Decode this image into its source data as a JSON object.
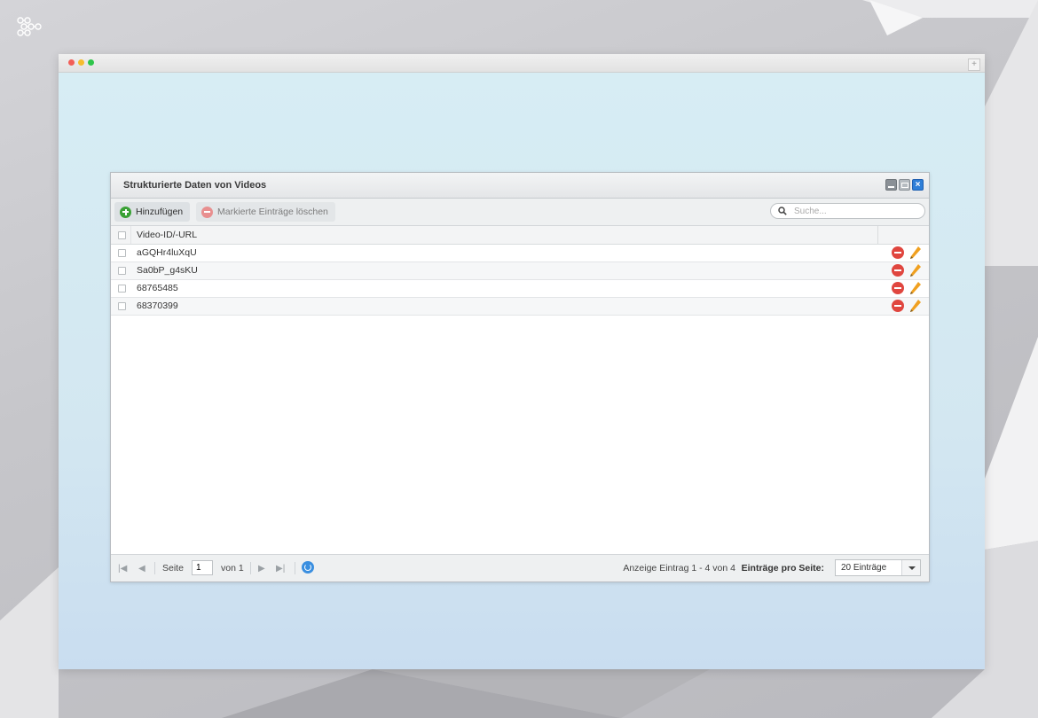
{
  "panel": {
    "title": "Strukturierte Daten von Videos"
  },
  "toolbar": {
    "add_label": "Hinzufügen",
    "delete_label": "Markierte Einträge löschen",
    "search_placeholder": "Suche..."
  },
  "grid": {
    "column_header": "Video-ID/-URL",
    "rows": [
      {
        "value": "aGQHr4luXqU"
      },
      {
        "value": "Sa0bP_g4sKU"
      },
      {
        "value": "68765485"
      },
      {
        "value": "68370399"
      }
    ]
  },
  "footer": {
    "page_label": "Seite",
    "page_value": "1",
    "of_label": "von 1",
    "status": "Anzeige Eintrag 1 - 4 von 4",
    "per_page_label": "Einträge pro Seite:",
    "per_page_value": "20 Einträge"
  },
  "colors": {
    "add_green": "#3aa135",
    "delete_red": "#e0463f",
    "edit_orange": "#f0a020",
    "close_blue": "#2f7fd8"
  },
  "icons": [
    "logo-icon",
    "plus-icon",
    "minus-icon",
    "search-icon",
    "delete-icon",
    "edit-icon",
    "first-page-icon",
    "prev-page-icon",
    "next-page-icon",
    "last-page-icon",
    "refresh-icon",
    "dropdown-icon"
  ]
}
